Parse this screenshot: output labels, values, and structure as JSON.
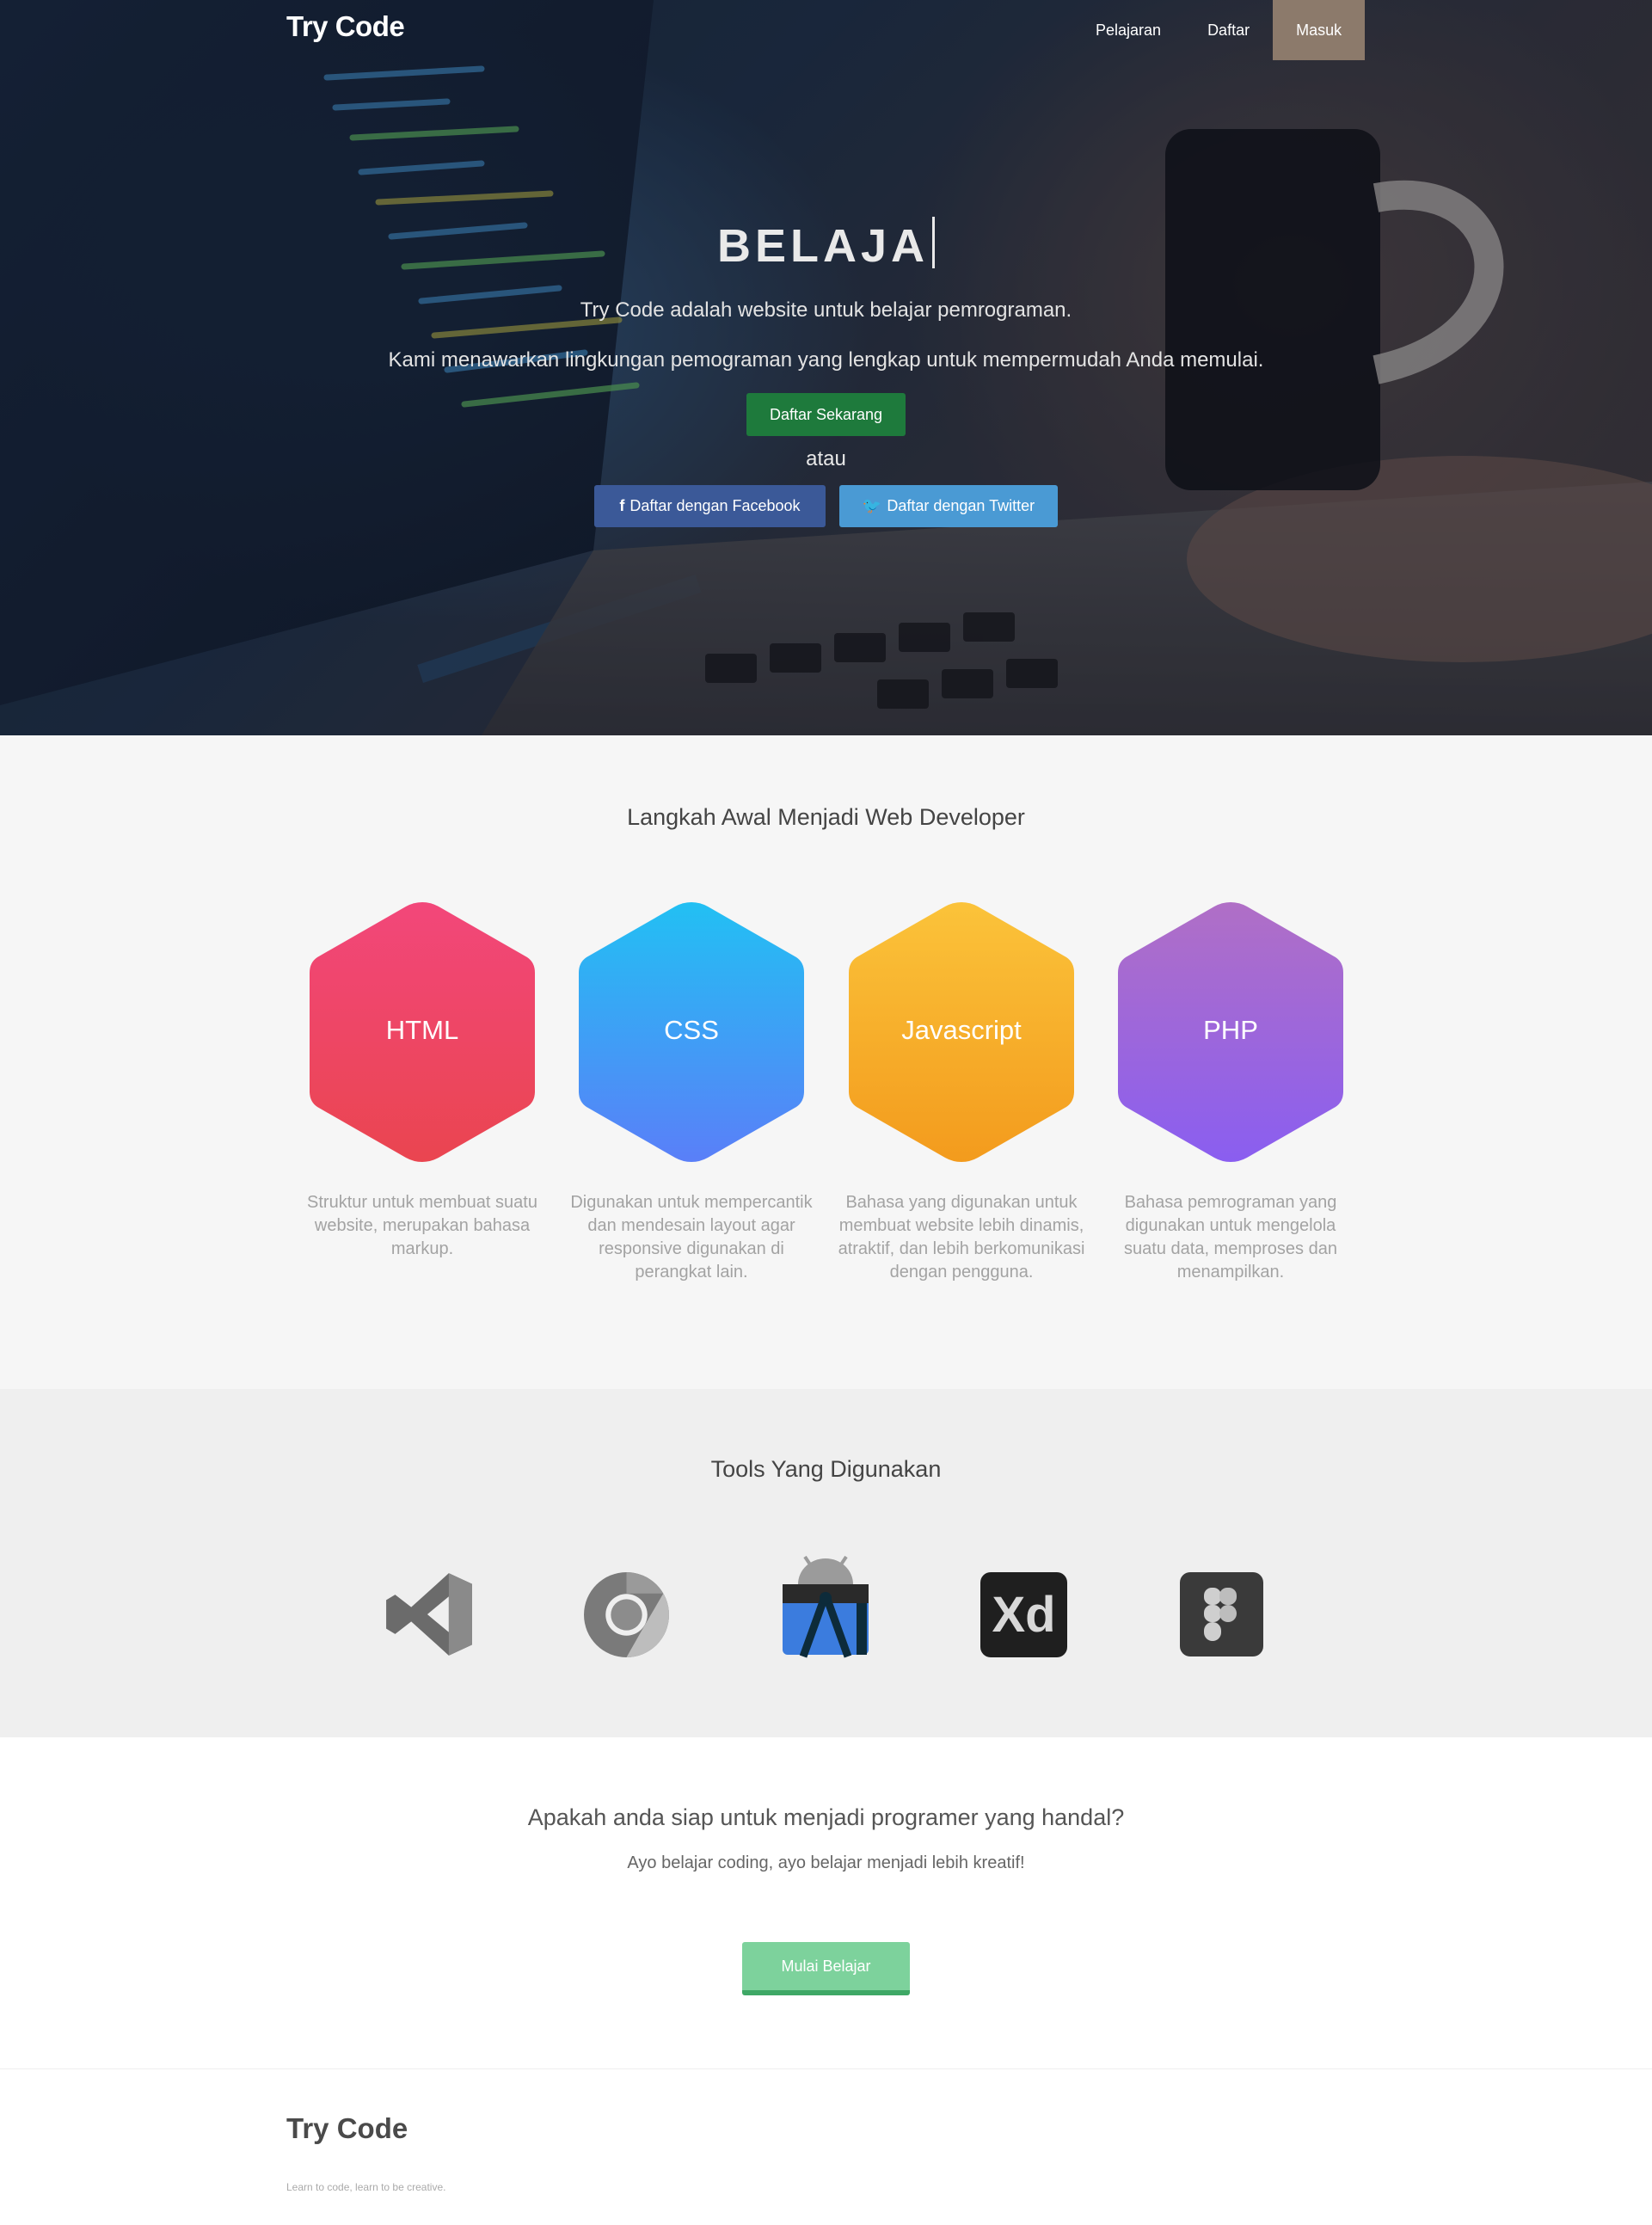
{
  "nav": {
    "logo": "Try Code",
    "items": [
      "Pelajaran",
      "Daftar",
      "Masuk"
    ]
  },
  "hero": {
    "title": "BELAJA",
    "subtitle1": "Try Code adalah website untuk belajar pemrograman.",
    "subtitle2": "Kami menawarkan lingkungan pemograman yang lengkap untuk mempermudah Anda memulai.",
    "primary_button": "Daftar Sekarang",
    "or_text": "atau",
    "facebook_button": "Daftar dengan Facebook",
    "twitter_button": "Daftar dengan Twitter"
  },
  "steps": {
    "title": "Langkah Awal Menjadi Web Developer",
    "items": [
      {
        "label": "HTML",
        "description": "Struktur untuk membuat suatu website, merupakan bahasa markup.",
        "colors": [
          "#f2477a",
          "#ea4550"
        ]
      },
      {
        "label": "CSS",
        "description": "Digunakan untuk mempercantik dan mendesain layout agar responsive digunakan di perangkat lain.",
        "colors": [
          "#22c0f3",
          "#5a7ff8"
        ]
      },
      {
        "label": "Javascript",
        "description": "Bahasa yang digunakan untuk membuat website lebih dinamis, atraktif, dan lebih berkomunikasi dengan pengguna.",
        "colors": [
          "#fbc33a",
          "#f39b1d"
        ]
      },
      {
        "label": "PHP",
        "description": "Bahasa pemrograman yang digunakan untuk mengelola suatu data, memproses dan menampilkan.",
        "colors": [
          "#b06fc6",
          "#8a5ef0"
        ]
      }
    ]
  },
  "tools": {
    "title": "Tools Yang Digunakan",
    "icons": [
      "vscode-icon",
      "chrome-icon",
      "android-studio-icon",
      "adobe-xd-icon",
      "figma-icon"
    ],
    "xd_text": "Xd"
  },
  "cta": {
    "title": "Apakah anda siap untuk menjadi programer yang handal?",
    "subtitle": "Ayo belajar coding, ayo belajar menjadi lebih kreatif!",
    "button": "Mulai Belajar"
  },
  "footer": {
    "logo": "Try Code",
    "tagline": "Learn to code, learn to be creative."
  },
  "colors": {
    "nav_active": "#8c7a6b",
    "primary_green": "#1e7a3c",
    "facebook": "#3b5998",
    "twitter": "#4a9ad4",
    "cta_green": "#7dd29c"
  }
}
